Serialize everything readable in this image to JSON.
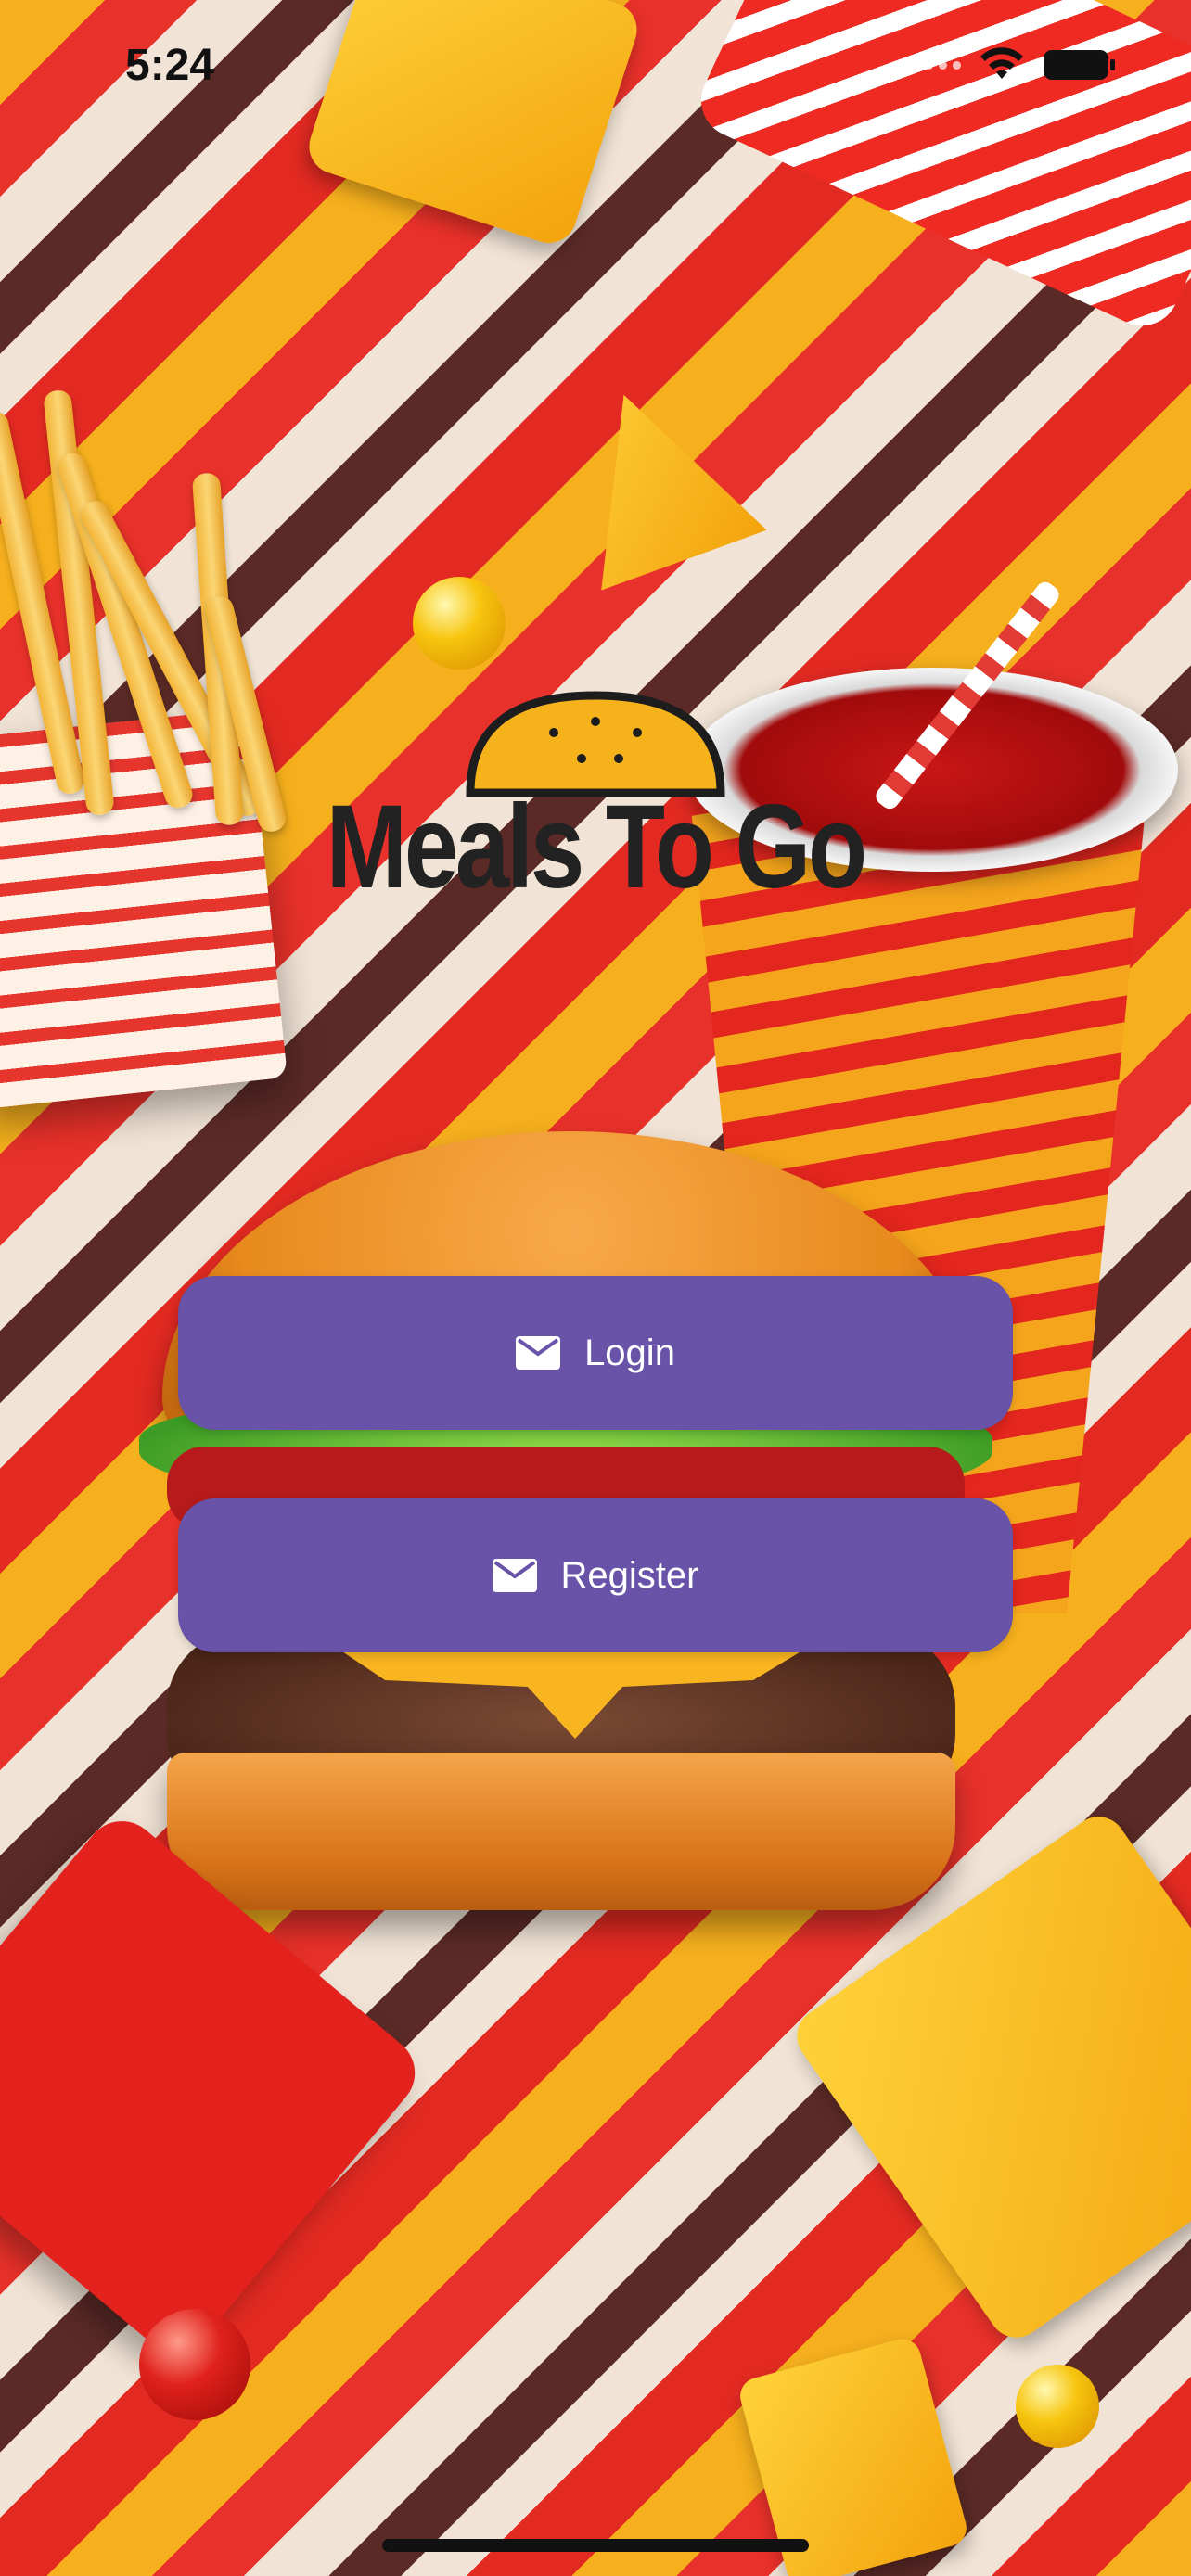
{
  "status_bar": {
    "time": "5:24",
    "icons": [
      "signal-dots-icon",
      "wifi-icon",
      "battery-icon"
    ]
  },
  "app": {
    "title": "Meals To Go",
    "logo_icon": "burger-bun-icon"
  },
  "actions": {
    "login_label": "Login",
    "register_label": "Register",
    "button_icon": "mail-icon"
  },
  "colors": {
    "button_bg": "#6853a8",
    "button_text": "#ffffff",
    "title_text": "#222222"
  }
}
